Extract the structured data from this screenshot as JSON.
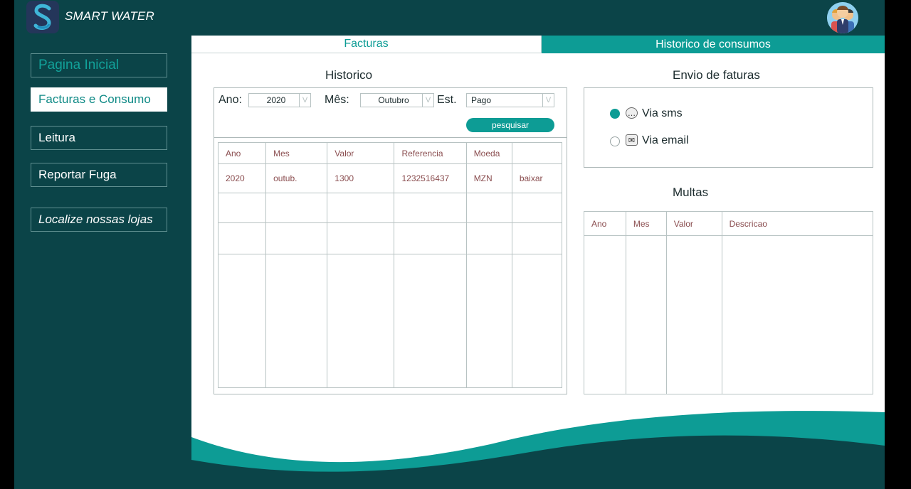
{
  "app": {
    "title": "SMART WATER"
  },
  "sidebar": {
    "items": [
      {
        "label": "Pagina Inicial"
      },
      {
        "label": "Facturas e Consumo"
      },
      {
        "label": "Leitura"
      },
      {
        "label": "Reportar Fuga"
      },
      {
        "label": "Localize nossas lojas"
      }
    ]
  },
  "tabs": [
    {
      "label": "Facturas"
    },
    {
      "label": "Historico de consumos"
    }
  ],
  "historico": {
    "title": "Historico",
    "filters": {
      "ano_label": "Ano:",
      "ano_value": "2020",
      "mes_label": "Mês:",
      "mes_value": "Outubro",
      "est_label": "Est.",
      "est_value": "Pago"
    },
    "search_button": "pesquisar",
    "columns": [
      "Ano",
      "Mes",
      "Valor",
      "Referencia",
      "Moeda",
      ""
    ],
    "rows": [
      [
        "2020",
        "outub.",
        "1300",
        "1232516437",
        "MZN",
        "baixar"
      ]
    ]
  },
  "envio": {
    "title": "Envio de faturas",
    "options": [
      {
        "label": "Via sms",
        "selected": true,
        "icon": "chat-icon"
      },
      {
        "label": "Via email",
        "selected": false,
        "icon": "mail-icon"
      }
    ]
  },
  "multas": {
    "title": "Multas",
    "columns": [
      "Ano",
      "Mes",
      "Valor",
      "Descricao"
    ]
  },
  "colors": {
    "brand": "#0b4448",
    "accent": "#0d9c95"
  }
}
